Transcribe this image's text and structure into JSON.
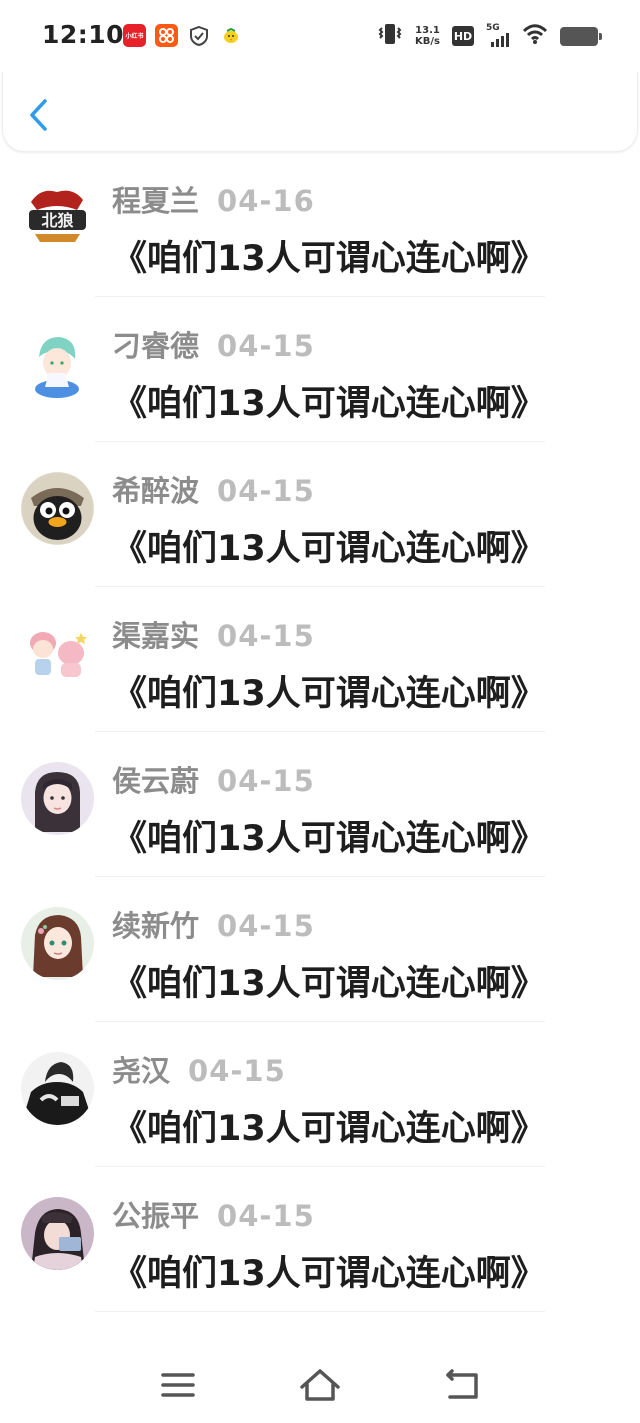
{
  "status": {
    "time": "12:10",
    "app_icons": [
      {
        "icon": "xiaohongshu-icon",
        "color": "#e8202a",
        "text": "小红书"
      },
      {
        "icon": "taobao-icon",
        "color": "#ff5a14",
        "text": ""
      },
      {
        "icon": "shield-check-icon",
        "color": "#444444",
        "text": ""
      },
      {
        "icon": "chick-icon",
        "color": "#f5d020",
        "text": ""
      }
    ],
    "net_speed_value": "13.1",
    "net_speed_unit": "KB/s",
    "hd_label": "HD",
    "network_label": "5G"
  },
  "list": {
    "items": [
      {
        "name": "程夏兰",
        "date": "04-16",
        "title": "《咱们13人可谓心连心啊》",
        "avatar": "wolf-logo-avatar"
      },
      {
        "name": "刁睿德",
        "date": "04-15",
        "title": "《咱们13人可谓心连心啊》",
        "avatar": "anime-boy-avatar"
      },
      {
        "name": "希醉波",
        "date": "04-15",
        "title": "《咱们13人可谓心连心啊》",
        "avatar": "penguin-pilot-avatar"
      },
      {
        "name": "渠嘉实",
        "date": "04-15",
        "title": "《咱们13人可谓心连心啊》",
        "avatar": "cartoon-couple-avatar"
      },
      {
        "name": "侯云蔚",
        "date": "04-15",
        "title": "《咱们13人可谓心连心啊》",
        "avatar": "girl-portrait-avatar"
      },
      {
        "name": "续新竹",
        "date": "04-15",
        "title": "《咱们13人可谓心连心啊》",
        "avatar": "anime-girl-avatar"
      },
      {
        "name": "尧汉",
        "date": "04-15",
        "title": "《咱们13人可谓心连心啊》",
        "avatar": "bw-photo-avatar"
      },
      {
        "name": "公振平",
        "date": "04-15",
        "title": "《咱们13人可谓心连心啊》",
        "avatar": "girl-card-avatar"
      }
    ]
  },
  "colors": {
    "accent": "#2f9bea",
    "name": "#8c8c8c",
    "date": "#bcbcbc",
    "title": "#1e1e1e"
  }
}
